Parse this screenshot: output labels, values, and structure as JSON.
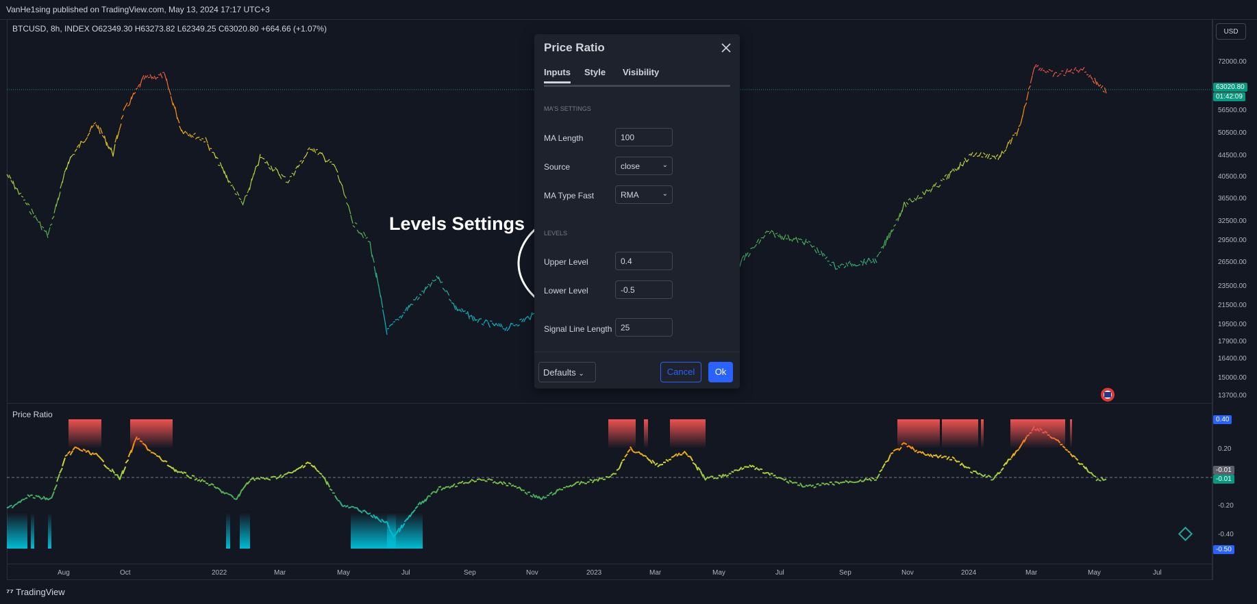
{
  "header": {
    "published_text": "VanHe1sing published on TradingView.com, May 13, 2024 17:17 UTC+3"
  },
  "symbol_line": "BTCUSD, 8h, INDEX  O62349.30  H63273.82  L62349.25  C63020.80  +664.66 (+1.07%)",
  "indicator_pane": {
    "label": "Price Ratio"
  },
  "annotation": "Levels Settings",
  "price_axis": {
    "currency": "USD",
    "labels": [
      "72000.00",
      "63020.80",
      "56500.00",
      "50500.00",
      "44500.00",
      "40500.00",
      "36500.00",
      "32500.00",
      "29500.00",
      "26500.00",
      "23500.00",
      "21500.00",
      "19500.00",
      "17900.00",
      "16400.00",
      "15000.00",
      "13700.00"
    ],
    "last_price_tag": "63020.80",
    "countdown_tag": "01:42:09"
  },
  "indicator_axis": {
    "labels": [
      "0.40",
      "0.20",
      "-0.01",
      "-0.01",
      "-0.20",
      "-0.40",
      "-0.50"
    ]
  },
  "time_axis": {
    "labels": [
      "Aug",
      "Oct",
      "2022",
      "Mar",
      "May",
      "Jul",
      "Sep",
      "Nov",
      "2023",
      "Mar",
      "May",
      "Jul",
      "Sep",
      "Nov",
      "2024",
      "Mar",
      "May",
      "Jul"
    ]
  },
  "footer": {
    "logo_text": "TradingView"
  },
  "dialog": {
    "title": "Price Ratio",
    "tabs": [
      "Inputs",
      "Style",
      "Visibility"
    ],
    "section_ma": "MA'S SETTINGS",
    "ma_length_label": "MA Length",
    "ma_length_value": "100",
    "source_label": "Source",
    "source_value": "close",
    "ma_type_label": "MA Type Fast",
    "ma_type_value": "RMA",
    "section_levels": "LEVELS",
    "upper_label": "Upper Level",
    "upper_value": "0.4",
    "lower_label": "Lower Level",
    "lower_value": "-0.5",
    "signal_label": "Signal Line Length",
    "signal_value": "25",
    "defaults_label": "Defaults",
    "cancel_label": "Cancel",
    "ok_label": "Ok"
  },
  "colors": {
    "accent": "#2962ff",
    "price_tag": "#089981",
    "background": "#131722",
    "dialog_bg": "#1e222d"
  }
}
